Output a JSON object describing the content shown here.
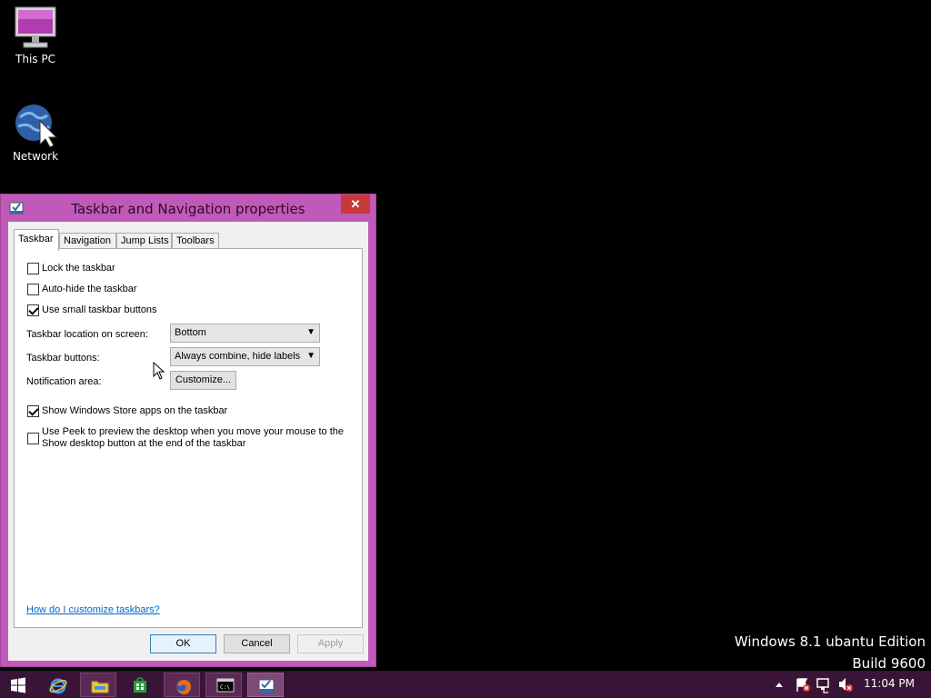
{
  "desktop": {
    "icons": [
      {
        "label": "This PC",
        "icon": "this-pc-icon"
      },
      {
        "label": "Network",
        "icon": "network-icon"
      }
    ],
    "watermark": {
      "line1": "Windows 8.1 ubantu Edition",
      "line2": "Build 9600"
    }
  },
  "dialog": {
    "title": "Taskbar and Navigation properties",
    "close_label": "✕",
    "tabs": [
      {
        "label": "Taskbar",
        "active": true
      },
      {
        "label": "Navigation",
        "active": false
      },
      {
        "label": "Jump Lists",
        "active": false
      },
      {
        "label": "Toolbars",
        "active": false
      }
    ],
    "checkboxes": [
      {
        "label": "Lock the taskbar",
        "checked": false
      },
      {
        "label": "Auto-hide the taskbar",
        "checked": false
      },
      {
        "label": "Use small taskbar buttons",
        "checked": true
      },
      {
        "label": "Show Windows Store apps on the taskbar",
        "checked": true
      },
      {
        "label": "Use Peek to preview the desktop when you move your mouse to the Show desktop button at the end of the taskbar",
        "checked": false
      }
    ],
    "location": {
      "label": "Taskbar location on screen:",
      "value": "Bottom"
    },
    "buttons_setting": {
      "label": "Taskbar buttons:",
      "value": "Always combine, hide labels"
    },
    "notification": {
      "label": "Notification area:",
      "button": "Customize..."
    },
    "help_link": "How do I customize taskbars?",
    "footer": {
      "ok": "OK",
      "cancel": "Cancel",
      "apply": "Apply"
    }
  },
  "taskbar": {
    "clock": "11:04 PM",
    "items": [
      "start-icon",
      "internet-explorer-icon",
      "file-explorer-icon",
      "store-icon",
      "firefox-icon",
      "command-prompt-icon",
      "taskbar-properties-icon"
    ]
  },
  "colors": {
    "accent": "#c05ab8",
    "taskbar": "#3a1436",
    "close": "#c7393a"
  }
}
